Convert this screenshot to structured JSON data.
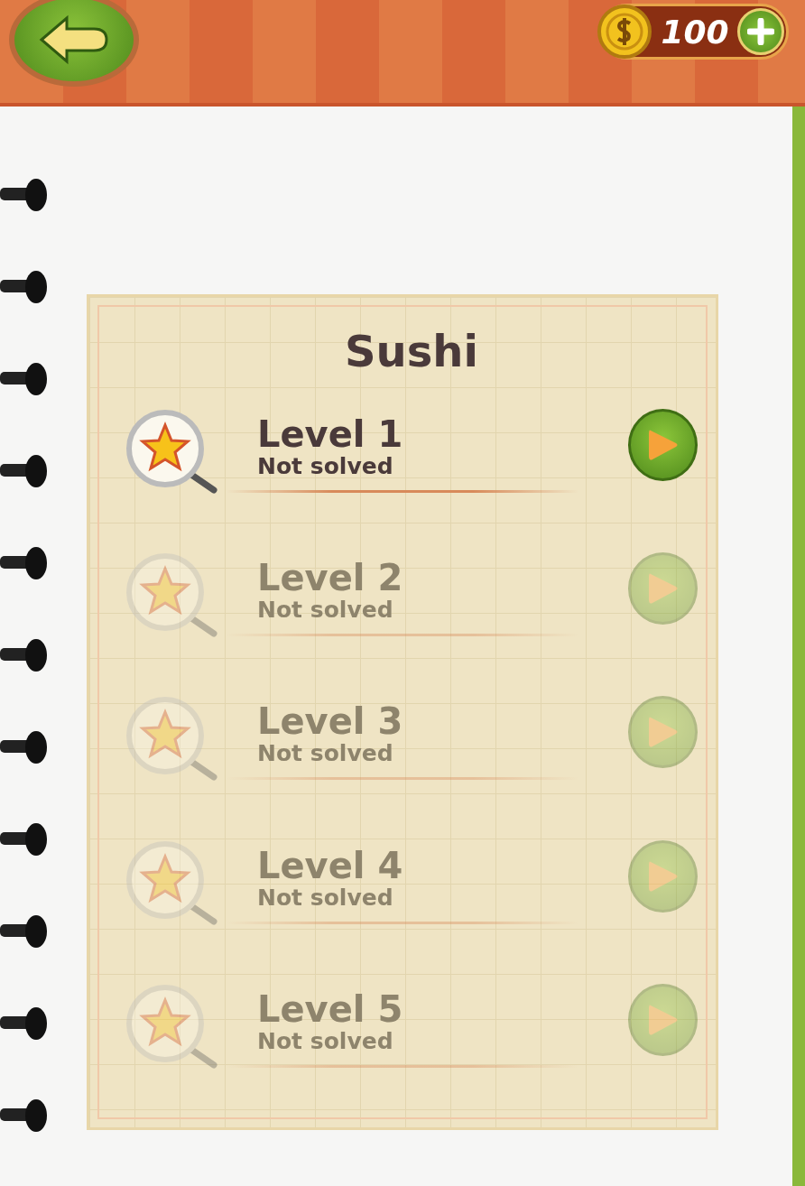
{
  "header": {
    "coins": "100"
  },
  "card": {
    "title": "Sushi",
    "levels": [
      {
        "name": "Level 1",
        "status": "Not solved",
        "locked": false
      },
      {
        "name": "Level 2",
        "status": "Not solved",
        "locked": true
      },
      {
        "name": "Level 3",
        "status": "Not solved",
        "locked": true
      },
      {
        "name": "Level 4",
        "status": "Not solved",
        "locked": true
      },
      {
        "name": "Level 5",
        "status": "Not solved",
        "locked": true
      }
    ]
  }
}
